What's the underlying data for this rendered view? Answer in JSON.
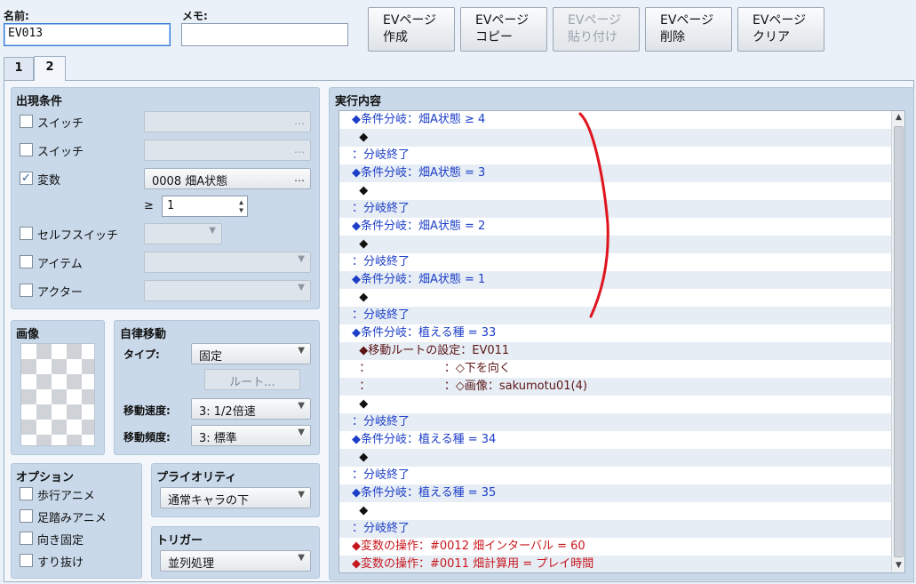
{
  "header": {
    "name_label": "名前:",
    "name_value": "EV013",
    "memo_label": "メモ:",
    "memo_value": ""
  },
  "toolbar": [
    {
      "line1": "EVページ",
      "line2": "作成",
      "enabled": true
    },
    {
      "line1": "EVページ",
      "line2": "コピー",
      "enabled": true
    },
    {
      "line1": "EVページ",
      "line2": "貼り付け",
      "enabled": false
    },
    {
      "line1": "EVページ",
      "line2": "削除",
      "enabled": true
    },
    {
      "line1": "EVページ",
      "line2": "クリア",
      "enabled": true
    }
  ],
  "tabs": [
    {
      "label": "1",
      "active": false
    },
    {
      "label": "2",
      "active": true
    }
  ],
  "conditions": {
    "title": "出現条件",
    "switch1": {
      "label": "スイッチ",
      "checked": false,
      "value": "",
      "btn": "…"
    },
    "switch2": {
      "label": "スイッチ",
      "checked": false,
      "value": "",
      "btn": "…"
    },
    "variable": {
      "label": "変数",
      "checked": true,
      "value": "0008 畑A状態",
      "btn": "…",
      "operator": "≥",
      "number": "1"
    },
    "self_switch": {
      "label": "セルフスイッチ",
      "checked": false
    },
    "item": {
      "label": "アイテム",
      "checked": false
    },
    "actor": {
      "label": "アクター",
      "checked": false
    }
  },
  "image": {
    "title": "画像"
  },
  "autonomous": {
    "title": "自律移動",
    "type_label": "タイプ:",
    "type_value": "固定",
    "route_btn": "ルート...",
    "speed_label": "移動速度:",
    "speed_value": "3: 1/2倍速",
    "freq_label": "移動頻度:",
    "freq_value": "3: 標準"
  },
  "options": {
    "title": "オプション",
    "walk": "歩行アニメ",
    "step": "足踏みアニメ",
    "dir_fix": "向き固定",
    "through": "すり抜け"
  },
  "priority": {
    "title": "プライオリティ",
    "value": "通常キャラの下"
  },
  "trigger": {
    "title": "トリガー",
    "value": "並列処理"
  },
  "contents": {
    "title": "実行内容",
    "lines": [
      {
        "text": "◆条件分岐：畑A状態 ≥ 4",
        "color": "blue"
      },
      {
        "text": "  ◆",
        "color": "black"
      },
      {
        "text": "：分岐終了",
        "color": "blue"
      },
      {
        "text": "◆条件分岐：畑A状態 = 3",
        "color": "blue"
      },
      {
        "text": "  ◆",
        "color": "black"
      },
      {
        "text": "：分岐終了",
        "color": "blue"
      },
      {
        "text": "◆条件分岐：畑A状態 = 2",
        "color": "blue"
      },
      {
        "text": "  ◆",
        "color": "black"
      },
      {
        "text": "：分岐終了",
        "color": "blue"
      },
      {
        "text": "◆条件分岐：畑A状態 = 1",
        "color": "blue"
      },
      {
        "text": "  ◆",
        "color": "black"
      },
      {
        "text": "：分岐終了",
        "color": "blue"
      },
      {
        "text": "◆条件分岐：植える種 = 33",
        "color": "blue"
      },
      {
        "text": "  ◆移動ルートの設定：EV011",
        "color": "dark"
      },
      {
        "text": "  ：                    ：◇下を向く",
        "color": "dark"
      },
      {
        "text": "  ：                    ：◇画像：sakumotu01(4)",
        "color": "dark"
      },
      {
        "text": "  ◆",
        "color": "black"
      },
      {
        "text": "：分岐終了",
        "color": "blue"
      },
      {
        "text": "◆条件分岐：植える種 = 34",
        "color": "blue"
      },
      {
        "text": "  ◆",
        "color": "black"
      },
      {
        "text": "：分岐終了",
        "color": "blue"
      },
      {
        "text": "◆条件分岐：植える種 = 35",
        "color": "blue"
      },
      {
        "text": "  ◆",
        "color": "black"
      },
      {
        "text": "：分岐終了",
        "color": "blue"
      },
      {
        "text": "◆変数の操作：#0012 畑インターバル = 60",
        "color": "red"
      },
      {
        "text": "◆変数の操作：#0011 畑計算用 = プレイ時間",
        "color": "red"
      }
    ]
  },
  "colors": {
    "blue": "#1d3fc8",
    "red": "#c8161d",
    "dark": "#5b1515",
    "annotation": "#e0141e"
  }
}
